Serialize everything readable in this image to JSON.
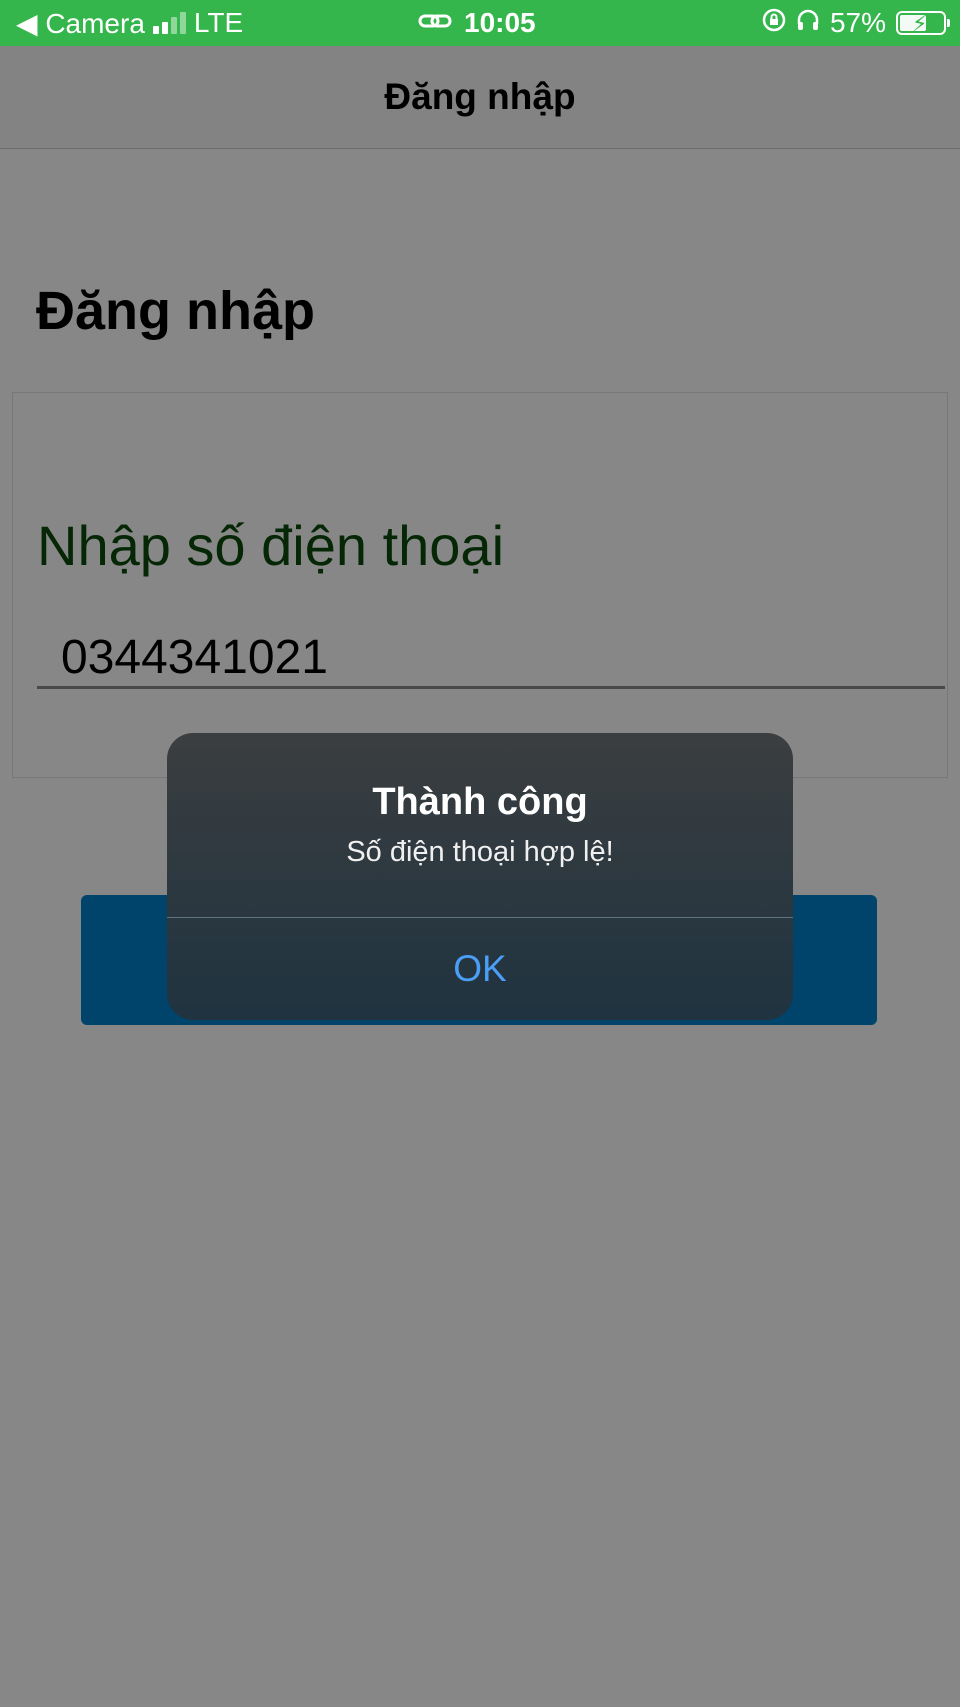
{
  "status_bar": {
    "back_label": "◀ Camera",
    "network": "LTE",
    "time": "10:05",
    "battery": "57%",
    "background_color": "#35b64c"
  },
  "nav": {
    "title": "Đăng nhập"
  },
  "page": {
    "heading": "Đăng nhập",
    "field_label": "Nhập số điện thoại",
    "phone_value": "0344341021",
    "submit_button_color": "#0080cc"
  },
  "alert": {
    "title": "Thành công",
    "message": "Số điện thoại hợp lệ!",
    "ok_label": "OK",
    "ok_color": "#4a9ef5"
  },
  "icons": [
    "back-arrow-icon",
    "signal-icon",
    "link-icon",
    "rotation-lock-icon",
    "headphones-icon",
    "battery-icon",
    "bolt-icon"
  ]
}
